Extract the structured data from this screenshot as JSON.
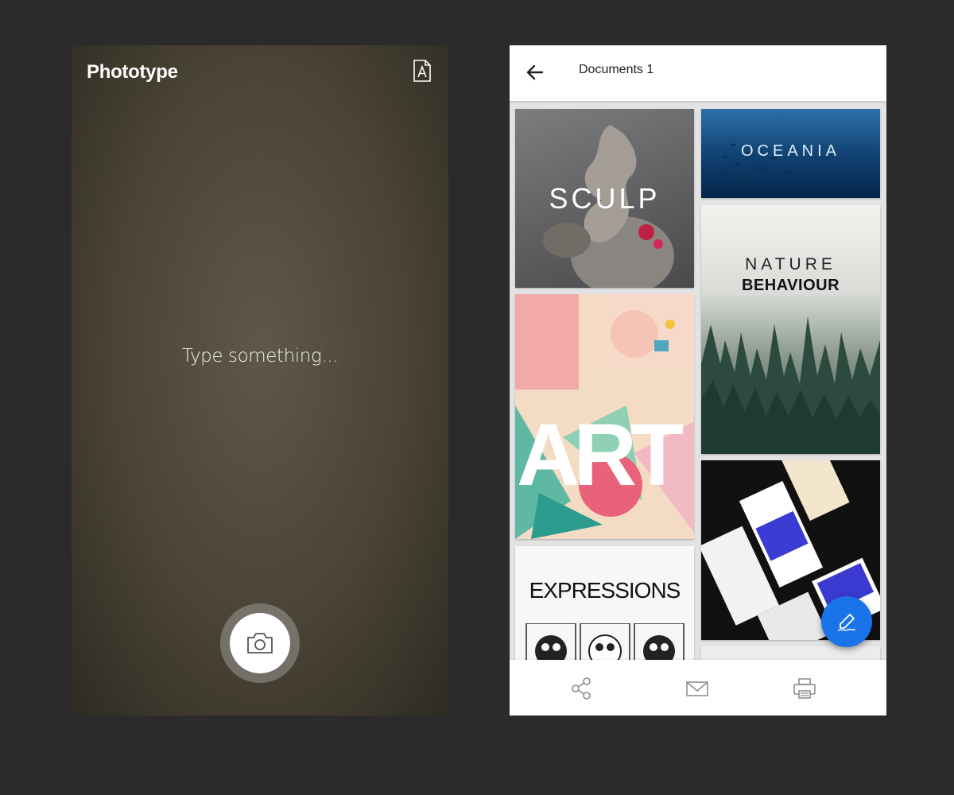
{
  "left_screen": {
    "app_name": "Phototype",
    "prompt": "Type something...",
    "icons": {
      "font": "font-document-icon",
      "camera": "camera-icon"
    }
  },
  "right_screen": {
    "title": "Documents 1",
    "icons": {
      "back": "arrow-left-icon",
      "fab": "signature-pen-icon"
    },
    "cards": {
      "sculp": "SCULP",
      "oceania": "OCEANIA",
      "nature_line1": "NATURE",
      "nature_line2": "BEHAVIOUR",
      "art": "ART",
      "expressions": "EXPRESSIONS"
    },
    "bottom_actions": [
      {
        "icon": "share-icon"
      },
      {
        "icon": "mail-icon"
      },
      {
        "icon": "print-icon"
      }
    ]
  },
  "colors": {
    "fab": "#1a73e8",
    "background": "#2b2b2b"
  }
}
